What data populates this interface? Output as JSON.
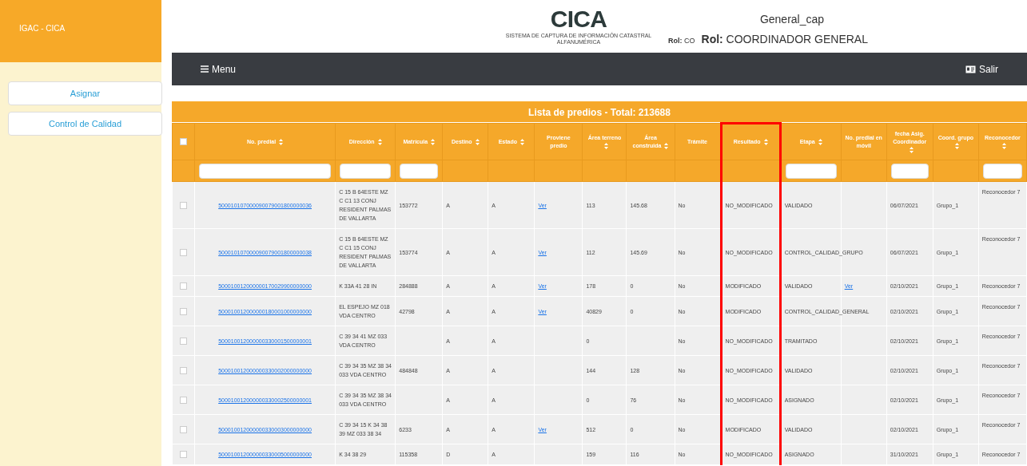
{
  "sidebar": {
    "title": "IGAC - CICA",
    "items": [
      {
        "label": "Asignar",
        "selected": false
      },
      {
        "label": "Control de Calidad",
        "selected": false
      }
    ]
  },
  "header": {
    "logo_text": "CICA",
    "logo_subtitle": "SISTEMA DE CAPTURA DE INFORMACIÓN CATASTRAL ALFANUMÉRICA",
    "role_short": "**Rol:** CO",
    "user": "General_cap",
    "role": "**Rol:** COORDINADOR GENERAL"
  },
  "navbar": {
    "menu": "Menu",
    "logout": "Salir"
  },
  "table": {
    "title": "Lista de predios - Total: 213688",
    "all_checked": false,
    "columns": [
      {
        "label": "No. predial",
        "sortable": true,
        "filter": true,
        "highlighted": false
      },
      {
        "label": "Dirección",
        "sortable": true,
        "filter": true,
        "highlighted": false
      },
      {
        "label": "Matrícula",
        "sortable": true,
        "filter": true,
        "highlighted": false
      },
      {
        "label": "Destino",
        "sortable": true,
        "filter": false,
        "highlighted": false
      },
      {
        "label": "Estado",
        "sortable": true,
        "filter": false,
        "highlighted": false
      },
      {
        "label": "Proviene predio",
        "sortable": false,
        "filter": false,
        "highlighted": false
      },
      {
        "label": "Área terreno",
        "sortable": true,
        "filter": false,
        "highlighted": false
      },
      {
        "label": "Área construida",
        "sortable": true,
        "filter": false,
        "highlighted": false
      },
      {
        "label": "Trámite",
        "sortable": false,
        "filter": false,
        "highlighted": false
      },
      {
        "label": "Resultado",
        "sortable": true,
        "filter": false,
        "highlighted": true
      },
      {
        "label": "Etapa",
        "sortable": true,
        "filter": true,
        "highlighted": false
      },
      {
        "label": "No. predial en móvil",
        "sortable": false,
        "filter": false,
        "highlighted": false
      },
      {
        "label": "fecha Asig. Coordinador",
        "sortable": true,
        "filter": true,
        "highlighted": false
      },
      {
        "label": "Coord. grupo",
        "sortable": true,
        "filter": false,
        "highlighted": false
      },
      {
        "label": "Reconocedor",
        "sortable": true,
        "filter": true,
        "highlighted": false
      }
    ],
    "rows": [
      {
        "checked": false,
        "cells": [
          {
            "kind": "link",
            "text": "500010107000090079001800000036"
          },
          {
            "kind": "text",
            "text": "C 15 B 64ESTE MZ C C1 13 CONJ RESIDENT PALMAS DE VALLARTA"
          },
          {
            "kind": "text",
            "text": "153772"
          },
          {
            "kind": "text",
            "text": "A"
          },
          {
            "kind": "text",
            "text": "A"
          },
          {
            "kind": "link",
            "text": "Ver"
          },
          {
            "kind": "text",
            "text": "113"
          },
          {
            "kind": "text",
            "text": "145.68"
          },
          {
            "kind": "text",
            "text": "No"
          },
          {
            "kind": "text",
            "text": "NO_MODIFICADO"
          },
          {
            "kind": "text",
            "text": "VALIDADO"
          },
          null,
          {
            "kind": "text",
            "text": "06/07/2021"
          },
          {
            "kind": "text",
            "text": "Grupo_1"
          },
          {
            "kind": "text",
            "text": "Reconocedor 7"
          }
        ]
      },
      {
        "checked": false,
        "cells": [
          {
            "kind": "link",
            "text": "500010107000090079001800000038"
          },
          {
            "kind": "text",
            "text": "C 15 B 64ESTE MZ C C1 15 CONJ RESIDENT PALMAS DE VALLARTA"
          },
          {
            "kind": "text",
            "text": "153774"
          },
          {
            "kind": "text",
            "text": "A"
          },
          {
            "kind": "text",
            "text": "A"
          },
          {
            "kind": "link",
            "text": "Ver"
          },
          {
            "kind": "text",
            "text": "112"
          },
          {
            "kind": "text",
            "text": "145.69"
          },
          {
            "kind": "text",
            "text": "No"
          },
          {
            "kind": "text",
            "text": "NO_MODIFICADO"
          },
          {
            "kind": "text",
            "text": "CONTROL_CALIDAD_GRUPO"
          },
          null,
          {
            "kind": "text",
            "text": "06/07/2021"
          },
          {
            "kind": "text",
            "text": "Grupo_1"
          },
          {
            "kind": "text",
            "text": "Reconocedor 7"
          }
        ]
      },
      {
        "checked": false,
        "cells": [
          {
            "kind": "link",
            "text": "500010012000000170029900000000"
          },
          {
            "kind": "text",
            "text": "K 33A 41 28 IN"
          },
          {
            "kind": "text",
            "text": "284888"
          },
          {
            "kind": "text",
            "text": "A"
          },
          {
            "kind": "text",
            "text": "A"
          },
          {
            "kind": "link",
            "text": "Ver"
          },
          {
            "kind": "text",
            "text": "178"
          },
          {
            "kind": "text",
            "text": "0"
          },
          {
            "kind": "text",
            "text": "No"
          },
          {
            "kind": "text",
            "text": "MODIFICADO"
          },
          {
            "kind": "text",
            "text": "VALIDADO"
          },
          {
            "kind": "link",
            "text": "Ver"
          },
          {
            "kind": "text",
            "text": "02/10/2021"
          },
          {
            "kind": "text",
            "text": "Grupo_1"
          },
          {
            "kind": "text",
            "text": "Reconocedor 7"
          }
        ]
      },
      {
        "checked": false,
        "cells": [
          {
            "kind": "link",
            "text": "500010012000000180001000000000"
          },
          {
            "kind": "text",
            "text": "EL ESPEJO MZ 018 VDA CENTRO"
          },
          {
            "kind": "text",
            "text": "42798"
          },
          {
            "kind": "text",
            "text": "A"
          },
          {
            "kind": "text",
            "text": "A"
          },
          {
            "kind": "link",
            "text": "Ver"
          },
          {
            "kind": "text",
            "text": "40829"
          },
          {
            "kind": "text",
            "text": "0"
          },
          {
            "kind": "text",
            "text": "No"
          },
          {
            "kind": "text",
            "text": "MODIFICADO"
          },
          {
            "kind": "text",
            "text": "CONTROL_CALIDAD_GENERAL"
          },
          null,
          {
            "kind": "text",
            "text": "02/10/2021"
          },
          {
            "kind": "text",
            "text": "Grupo_1"
          },
          {
            "kind": "text",
            "text": "Reconocedor 7"
          }
        ]
      },
      {
        "checked": false,
        "cells": [
          {
            "kind": "link",
            "text": "500010012000000330001500000001"
          },
          {
            "kind": "text",
            "text": "C 39 34 41 MZ 033 VDA CENTRO"
          },
          null,
          {
            "kind": "text",
            "text": "A"
          },
          {
            "kind": "text",
            "text": "A"
          },
          null,
          {
            "kind": "text",
            "text": "0"
          },
          null,
          {
            "kind": "text",
            "text": "No"
          },
          {
            "kind": "text",
            "text": "NO_MODIFICADO"
          },
          {
            "kind": "text",
            "text": "TRAMITADO"
          },
          null,
          {
            "kind": "text",
            "text": "02/10/2021"
          },
          {
            "kind": "text",
            "text": "Grupo_1"
          },
          {
            "kind": "text",
            "text": "Reconocedor 7"
          }
        ]
      },
      {
        "checked": false,
        "cells": [
          {
            "kind": "link",
            "text": "500010012000000330002000000000"
          },
          {
            "kind": "text",
            "text": "C 39 34 35 MZ 38 34 033 VDA CENTRO"
          },
          {
            "kind": "text",
            "text": "484848"
          },
          {
            "kind": "text",
            "text": "A"
          },
          {
            "kind": "text",
            "text": "A"
          },
          null,
          {
            "kind": "text",
            "text": "144"
          },
          {
            "kind": "text",
            "text": "128"
          },
          {
            "kind": "text",
            "text": "No"
          },
          {
            "kind": "text",
            "text": "NO_MODIFICADO"
          },
          {
            "kind": "text",
            "text": "VALIDADO"
          },
          null,
          {
            "kind": "text",
            "text": "02/10/2021"
          },
          {
            "kind": "text",
            "text": "Grupo_1"
          },
          {
            "kind": "text",
            "text": "Reconocedor 7"
          }
        ]
      },
      {
        "checked": false,
        "cells": [
          {
            "kind": "link",
            "text": "500010012000000330002500000001"
          },
          {
            "kind": "text",
            "text": "C 39 34 35 MZ 38 34 033 VDA CENTRO"
          },
          null,
          {
            "kind": "text",
            "text": "A"
          },
          {
            "kind": "text",
            "text": "A"
          },
          null,
          {
            "kind": "text",
            "text": "0"
          },
          {
            "kind": "text",
            "text": "76"
          },
          {
            "kind": "text",
            "text": "No"
          },
          {
            "kind": "text",
            "text": "NO_MODIFICADO"
          },
          {
            "kind": "text",
            "text": "ASIGNADO"
          },
          null,
          {
            "kind": "text",
            "text": "02/10/2021"
          },
          {
            "kind": "text",
            "text": "Grupo_1"
          },
          {
            "kind": "text",
            "text": "Reconocedor 7"
          }
        ]
      },
      {
        "checked": false,
        "cells": [
          {
            "kind": "link",
            "text": "500010012000000330003000000000"
          },
          {
            "kind": "text",
            "text": "C 39 34 15 K 34 38 39 MZ 033 38 34"
          },
          {
            "kind": "text",
            "text": "6233"
          },
          {
            "kind": "text",
            "text": "A"
          },
          {
            "kind": "text",
            "text": "A"
          },
          {
            "kind": "link",
            "text": "Ver"
          },
          {
            "kind": "text",
            "text": "512"
          },
          {
            "kind": "text",
            "text": "0"
          },
          {
            "kind": "text",
            "text": "No"
          },
          {
            "kind": "text",
            "text": "MODIFICADO"
          },
          {
            "kind": "text",
            "text": "VALIDADO"
          },
          null,
          {
            "kind": "text",
            "text": "02/10/2021"
          },
          {
            "kind": "text",
            "text": "Grupo_1"
          },
          {
            "kind": "text",
            "text": "Reconocedor 7"
          }
        ]
      },
      {
        "checked": false,
        "cells": [
          {
            "kind": "link",
            "text": "500010012000000330005000000000"
          },
          {
            "kind": "text",
            "text": "K 34 38 29"
          },
          {
            "kind": "text",
            "text": "115358"
          },
          {
            "kind": "text",
            "text": "D"
          },
          {
            "kind": "text",
            "text": "A"
          },
          null,
          {
            "kind": "text",
            "text": "159"
          },
          {
            "kind": "text",
            "text": "116"
          },
          {
            "kind": "text",
            "text": "No"
          },
          {
            "kind": "text",
            "text": "NO_MODIFICADO"
          },
          {
            "kind": "text",
            "text": "ASIGNADO"
          },
          null,
          {
            "kind": "text",
            "text": "31/10/2021"
          },
          {
            "kind": "text",
            "text": "Grupo_1"
          },
          {
            "kind": "text",
            "text": "Reconocedor 7"
          }
        ]
      }
    ]
  }
}
